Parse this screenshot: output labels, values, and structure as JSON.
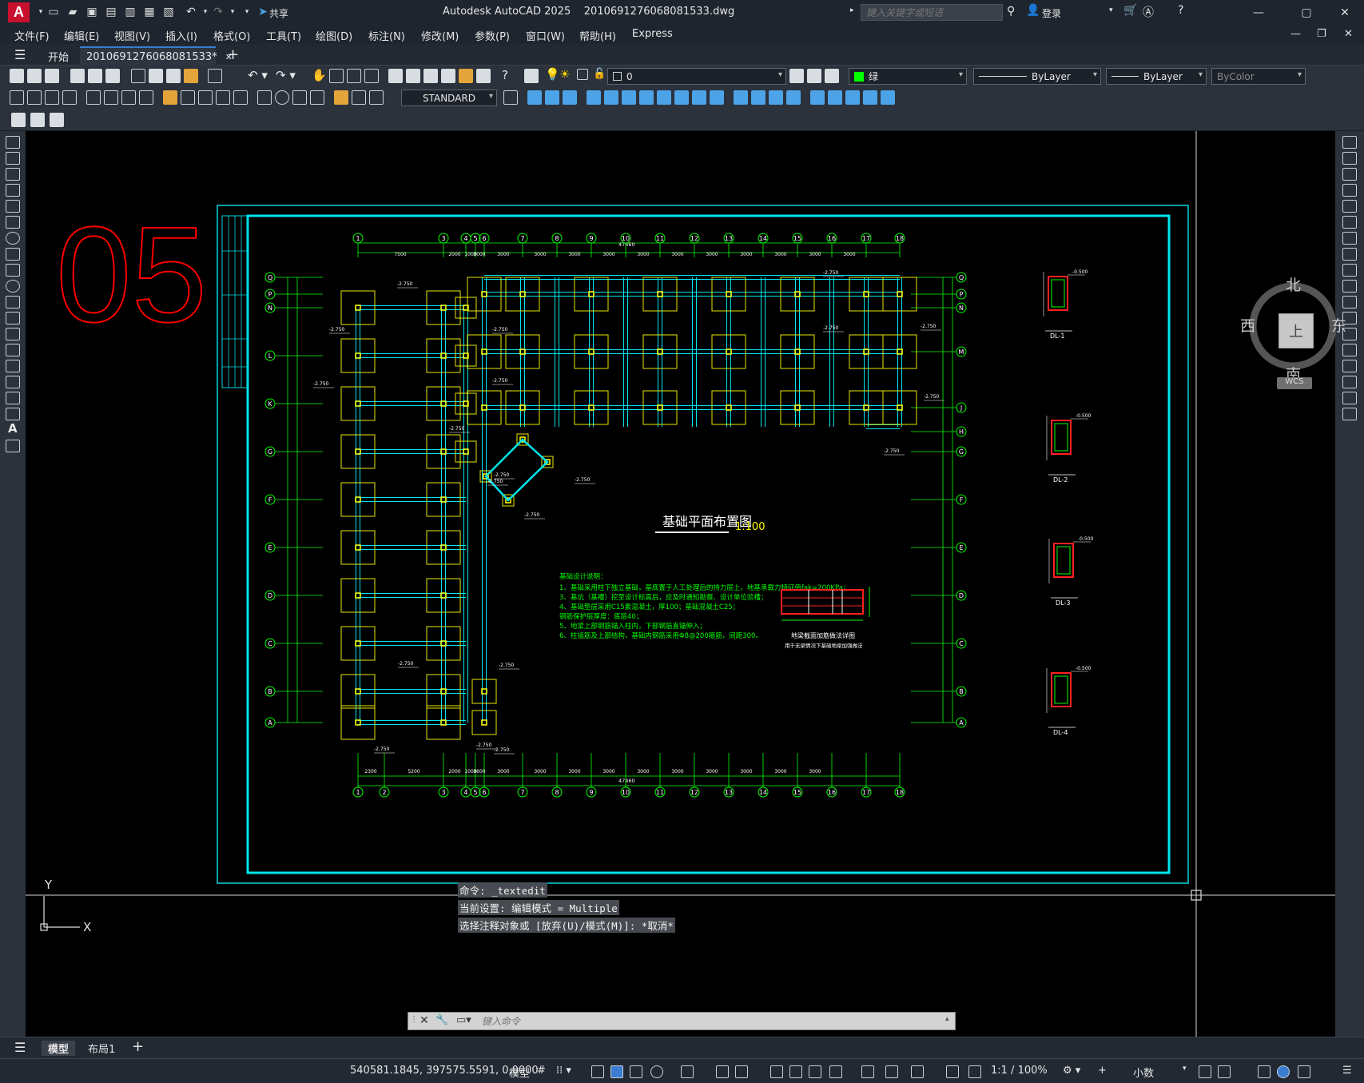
{
  "app": {
    "logo_letter": "A",
    "share_label": "共享",
    "title": "Autodesk AutoCAD 2025",
    "filename": "2010691276068081533.dwg",
    "search_placeholder": "键入关键字或短语",
    "login_label": "登录"
  },
  "menu": [
    "文件(F)",
    "编辑(E)",
    "视图(V)",
    "插入(I)",
    "格式(O)",
    "工具(T)",
    "绘图(D)",
    "标注(N)",
    "修改(M)",
    "参数(P)",
    "窗口(W)",
    "帮助(H)",
    "Express"
  ],
  "tabs": {
    "start": "开始",
    "file": "2010691276068081533*"
  },
  "toolbar": {
    "layer_value": "0",
    "text_style": "STANDARD",
    "color_value": "绿",
    "linetype_value": "ByLayer",
    "lineweight_value": "ByLayer",
    "plotstyle_value": "ByColor"
  },
  "drawing": {
    "sheet_number": "05",
    "title": "基础平面布置图",
    "scale": "1:100",
    "grid_top": [
      "1",
      "3",
      "4",
      "5",
      "6",
      "7",
      "8",
      "9",
      "10",
      "11",
      "12",
      "13",
      "14",
      "15",
      "16",
      "17",
      "18"
    ],
    "grid_bottom": [
      "1",
      "2",
      "3",
      "4",
      "5",
      "6",
      "7",
      "8",
      "9",
      "10",
      "11",
      "12",
      "13",
      "14",
      "15",
      "16",
      "17",
      "18"
    ],
    "grid_left": [
      "Q",
      "P",
      "N",
      "L",
      "K",
      "G",
      "F",
      "E",
      "D",
      "C",
      "B",
      "A"
    ],
    "grid_right": [
      "Q",
      "P",
      "N",
      "M",
      "J",
      "H",
      "G",
      "F",
      "E",
      "D",
      "C",
      "B",
      "A"
    ],
    "dims_top": [
      "7500",
      "2000",
      "1000",
      "3000",
      "3000",
      "3000",
      "3000",
      "3000",
      "3000",
      "3000",
      "3000",
      "3000",
      "3000",
      "3000",
      "3000"
    ],
    "dims_bottom": [
      "2300",
      "5200",
      "2000",
      "1000",
      "3600",
      "3000",
      "3000",
      "3000",
      "3000",
      "3000",
      "3000",
      "3000",
      "3000",
      "3000",
      "3000"
    ],
    "total_dim": "47460",
    "notes_title": "基础设计说明：",
    "notes": [
      "1、基础采用柱下独立基础，基底置于人工处理后的持力层上，地基承载力特征值fak=200KPa；",
      "3、基坑（基槽）挖至设计标高后，应及时通知勘察、设计单位验槽；",
      "4、基础垫层采用C15素混凝土，厚100；基础混凝土C25；",
      "   钢筋保护层厚度：底层40；",
      "5、地梁上部钢筋锚入柱内，下部钢筋直锚伸入；",
      "6、柱插筋及上部结构，基础内钢筋采用Φ8@200箍筋，间距300。"
    ],
    "detail_title": "地梁截面加筋做法详图",
    "detail_subtitle": "用于无梁情况下基础地梁加强做法",
    "sections": [
      "DL-1",
      "DL-2",
      "DL-3",
      "DL-4"
    ],
    "section_elev": "-0.500",
    "footing_elev": "-2.750",
    "compass": {
      "n": "北",
      "s": "南",
      "e": "东",
      "w": "西",
      "top": "上",
      "wcs": "WCS"
    },
    "ucs_x": "X",
    "ucs_y": "Y"
  },
  "command": {
    "history": [
      "命令: _textedit",
      "当前设置: 编辑模式 = Multiple",
      "选择注释对象或 [放弃(U)/模式(M)]: *取消*"
    ],
    "placeholder": "键入命令"
  },
  "layout_tabs": {
    "model": "模型",
    "layout1": "布局1"
  },
  "status": {
    "coords": "540581.1845, 397575.5591, 0.0000",
    "model": "模型",
    "scale": "1:1 / 100%",
    "units": "小数"
  },
  "colors": {
    "accent": "#3b7cd0",
    "cyan": "#00ffff",
    "green": "#00ff00",
    "yellow": "#ffff00",
    "red": "#ff0000",
    "title_red": "#c8102e"
  }
}
